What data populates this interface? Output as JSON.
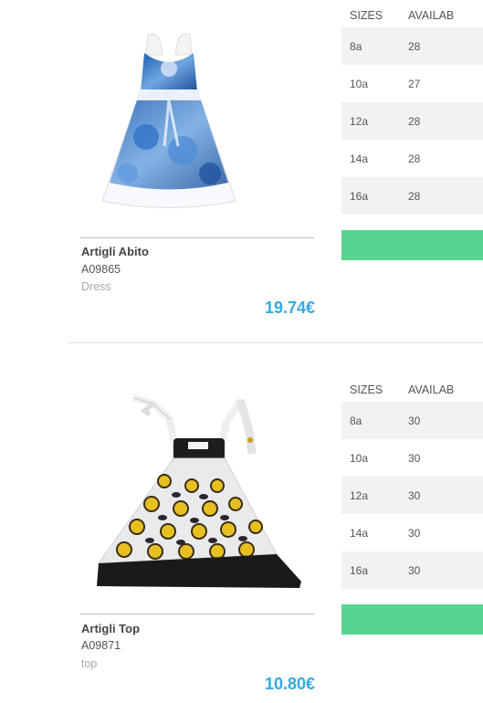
{
  "products": [
    {
      "name": "Artigli Abito",
      "code": "A09865",
      "category": "Dress",
      "price": "19.74€",
      "image_icon": "dress-image",
      "table": {
        "header_sizes": "SIZES",
        "header_available": "AVAILAB",
        "rows": [
          {
            "size": "8a",
            "qty": "28"
          },
          {
            "size": "10a",
            "qty": "27"
          },
          {
            "size": "12a",
            "qty": "28"
          },
          {
            "size": "14a",
            "qty": "28"
          },
          {
            "size": "16a",
            "qty": "28"
          }
        ]
      }
    },
    {
      "name": "Artigli Top",
      "code": "A09871",
      "category": "top",
      "price": "10.80€",
      "image_icon": "top-image",
      "table": {
        "header_sizes": "SIZES",
        "header_available": "AVAILAB",
        "rows": [
          {
            "size": "8a",
            "qty": "30"
          },
          {
            "size": "10a",
            "qty": "30"
          },
          {
            "size": "12a",
            "qty": "30"
          },
          {
            "size": "14a",
            "qty": "30"
          },
          {
            "size": "16a",
            "qty": "30"
          }
        ]
      }
    }
  ],
  "colors": {
    "price": "#35a9e0",
    "add_button": "#57d590",
    "row_alt": "#f2f2f2"
  }
}
